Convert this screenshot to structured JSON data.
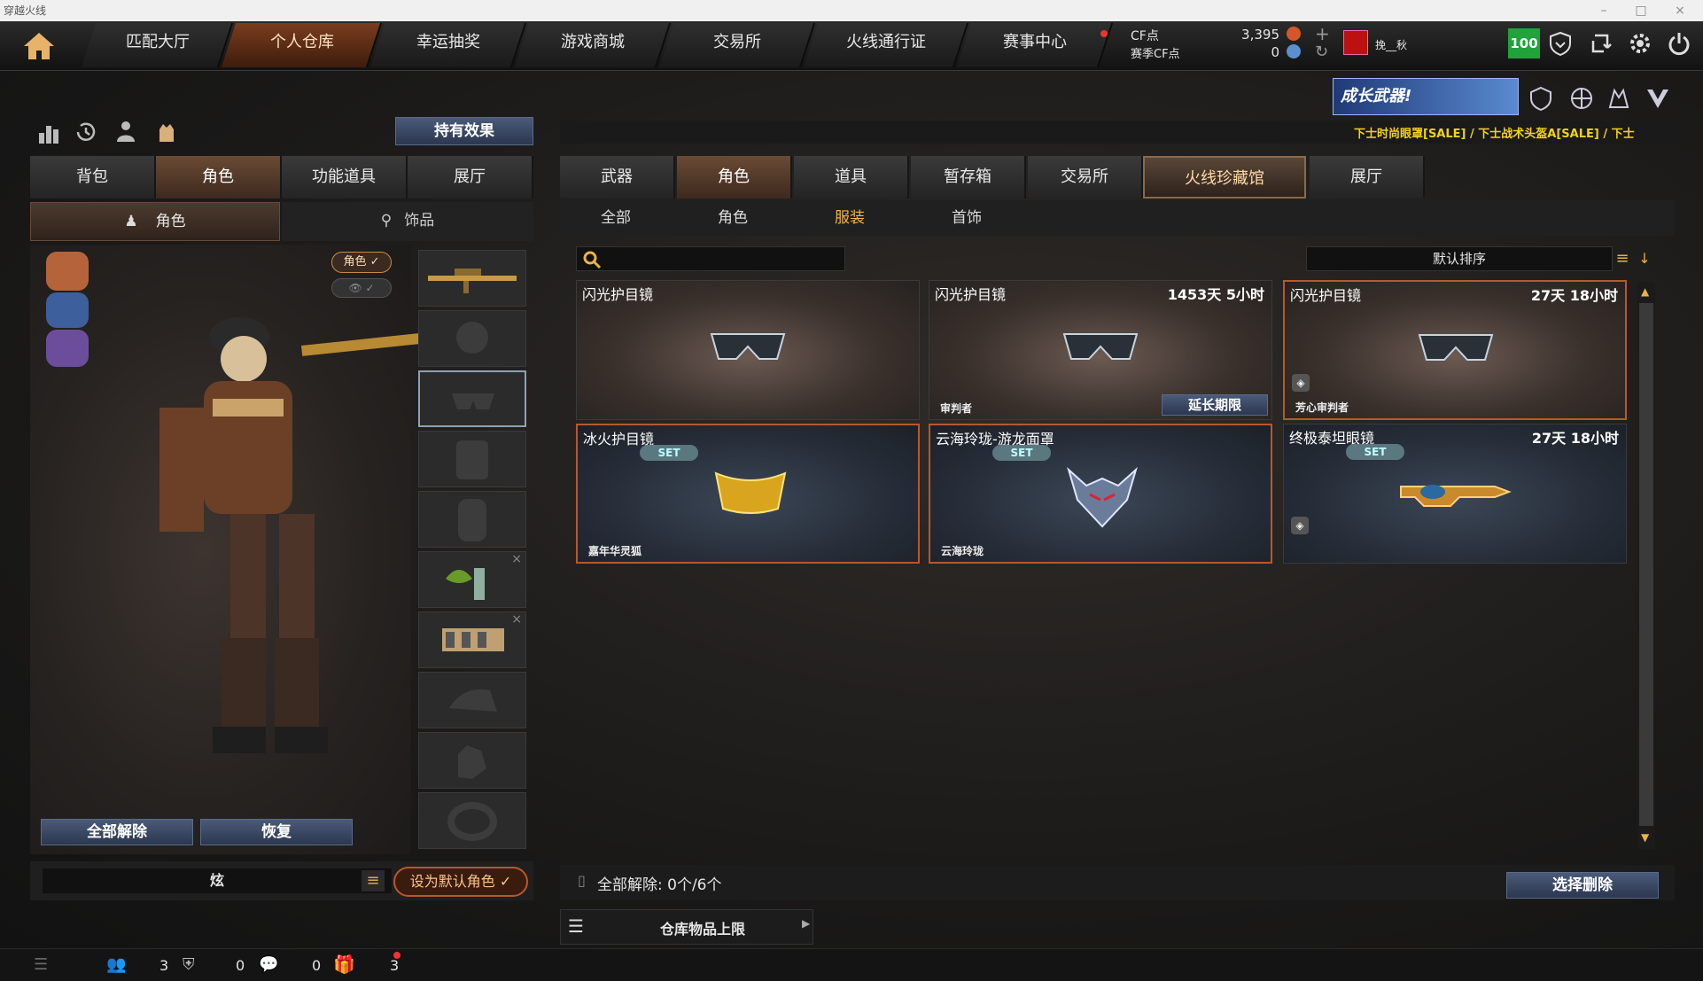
{
  "window": {
    "title": "穿越火线"
  },
  "nav": {
    "tabs": [
      "匹配大厅",
      "个人仓库",
      "幸运抽奖",
      "游戏商城",
      "交易所",
      "火线通行证",
      "赛事中心"
    ],
    "active": 1
  },
  "currency": {
    "cf_label": "CF点",
    "cf_value": "3,395",
    "season_label": "赛季CF点",
    "season_value": "0"
  },
  "user": {
    "name": "挽__秋",
    "level": "100"
  },
  "left": {
    "effect_button": "持有效果",
    "tabs": [
      "背包",
      "角色",
      "功能道具",
      "展厅"
    ],
    "subtabs": [
      "角色",
      "饰品"
    ],
    "badge_role": "角色 ✓",
    "unequip_all": "全部解除",
    "restore": "恢复",
    "char_name": "炫",
    "set_default": "设为默认角色 ✓"
  },
  "right": {
    "banner": "成长武器!",
    "ticker": "下士时尚眼罩[SALE] / 下士战术头盔A[SALE] / 下士",
    "tabs": [
      "武器",
      "角色",
      "道具",
      "暂存箱",
      "交易所",
      "火线珍藏馆",
      "展厅"
    ],
    "subtabs": [
      "全部",
      "角色",
      "服装",
      "首饰"
    ],
    "search_placeholder": "",
    "sort_label": "默认排序",
    "items": [
      {
        "name": "闪光护目镜",
        "time": "",
        "sub": "",
        "set": "",
        "theme": "brown"
      },
      {
        "name": "闪光护目镜",
        "time": "1453天 5小时",
        "sub": "审判者",
        "extend": "延长期限",
        "theme": "brown"
      },
      {
        "name": "闪光护目镜",
        "time": "27天 18小时",
        "sub": "芳心审判者",
        "theme": "brown"
      },
      {
        "name": "冰火护目镜",
        "time": "",
        "sub": "嘉年华灵狐",
        "set": "SET",
        "theme": "blue"
      },
      {
        "name": "云海玲珑-游龙面罩",
        "time": "",
        "sub": "云海玲珑",
        "set": "SET",
        "theme": "blue"
      },
      {
        "name": "终极泰坦眼镜",
        "time": "27天 18小时",
        "sub": "",
        "set": "SET",
        "theme": "blue"
      }
    ],
    "unequip_text": "全部解除:",
    "unequip_count": "0个/6个",
    "select_delete": "选择删除",
    "storage_limit": "仓库物品上限"
  },
  "statusbar": {
    "friends": "3",
    "shield": "0",
    "chat": "0",
    "gift": "3"
  }
}
